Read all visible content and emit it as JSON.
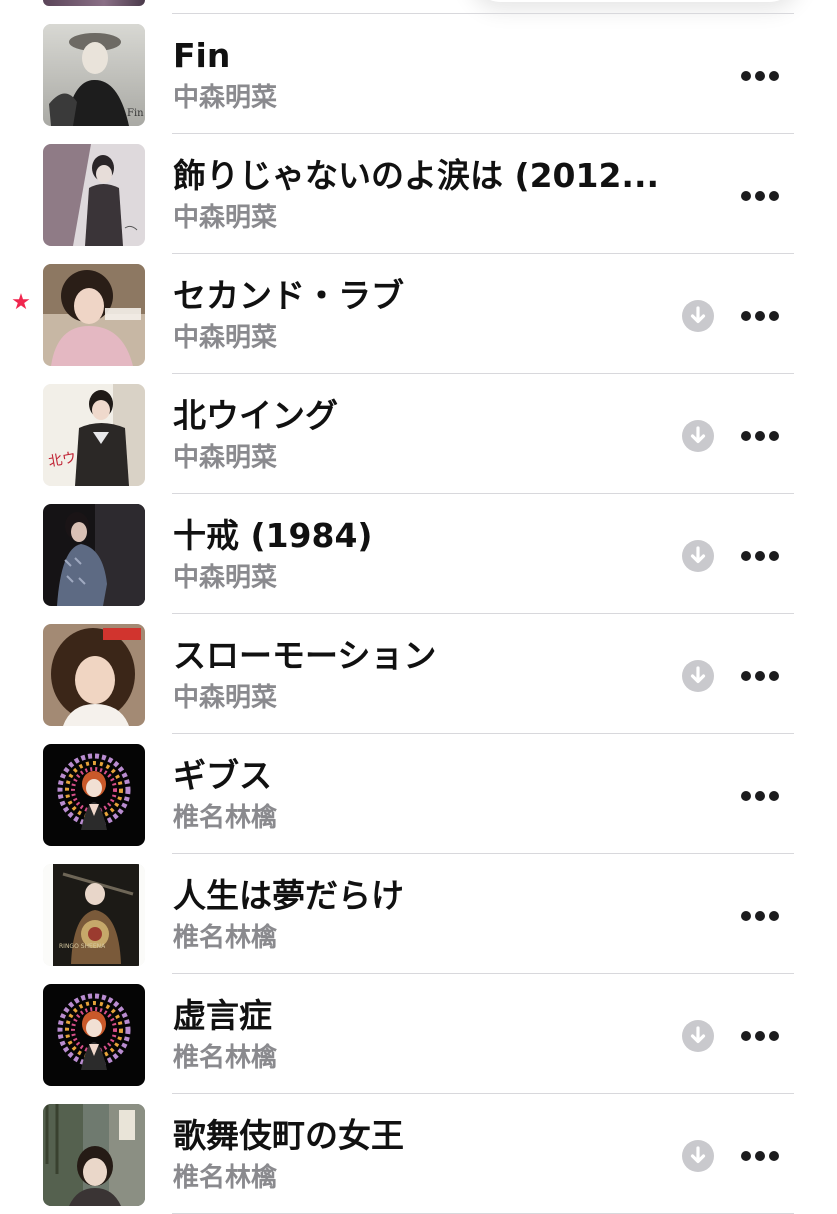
{
  "colors": {
    "favorite": "#f0264e",
    "title_text": "#111111",
    "artist_text": "#8a8a8e",
    "download_icon": "#c9c9cd",
    "separator": "#d8d8dc"
  },
  "tracks": [
    {
      "title": "Fin",
      "artist": "中森明菜",
      "artwork": "artwork-fin",
      "favorite": false,
      "downloadable": false
    },
    {
      "title": "飾りじゃないのよ涙は (2012...",
      "artist": "中森明菜",
      "artwork": "artwork-kazari",
      "favorite": false,
      "downloadable": false
    },
    {
      "title": "セカンド・ラブ",
      "artist": "中森明菜",
      "artwork": "artwork-second-love",
      "favorite": true,
      "downloadable": true
    },
    {
      "title": "北ウイング",
      "artist": "中森明菜",
      "artwork": "artwork-kita-wing",
      "favorite": false,
      "downloadable": true
    },
    {
      "title": "十戒 (1984)",
      "artist": "中森明菜",
      "artwork": "artwork-jukkai",
      "favorite": false,
      "downloadable": true
    },
    {
      "title": "スローモーション",
      "artist": "中森明菜",
      "artwork": "artwork-prologue",
      "favorite": false,
      "downloadable": true
    },
    {
      "title": "ギブス",
      "artist": "椎名林檎",
      "artwork": "artwork-shinagawa",
      "favorite": false,
      "downloadable": false
    },
    {
      "title": "人生は夢だらけ",
      "artist": "椎名林檎",
      "artwork": "artwork-newyork",
      "favorite": false,
      "downloadable": false
    },
    {
      "title": "虚言症",
      "artist": "椎名林檎",
      "artwork": "artwork-shinagawa",
      "favorite": false,
      "downloadable": true
    },
    {
      "title": "歌舞伎町の女王",
      "artist": "椎名林檎",
      "artwork": "artwork-muzai",
      "favorite": false,
      "downloadable": true
    }
  ]
}
